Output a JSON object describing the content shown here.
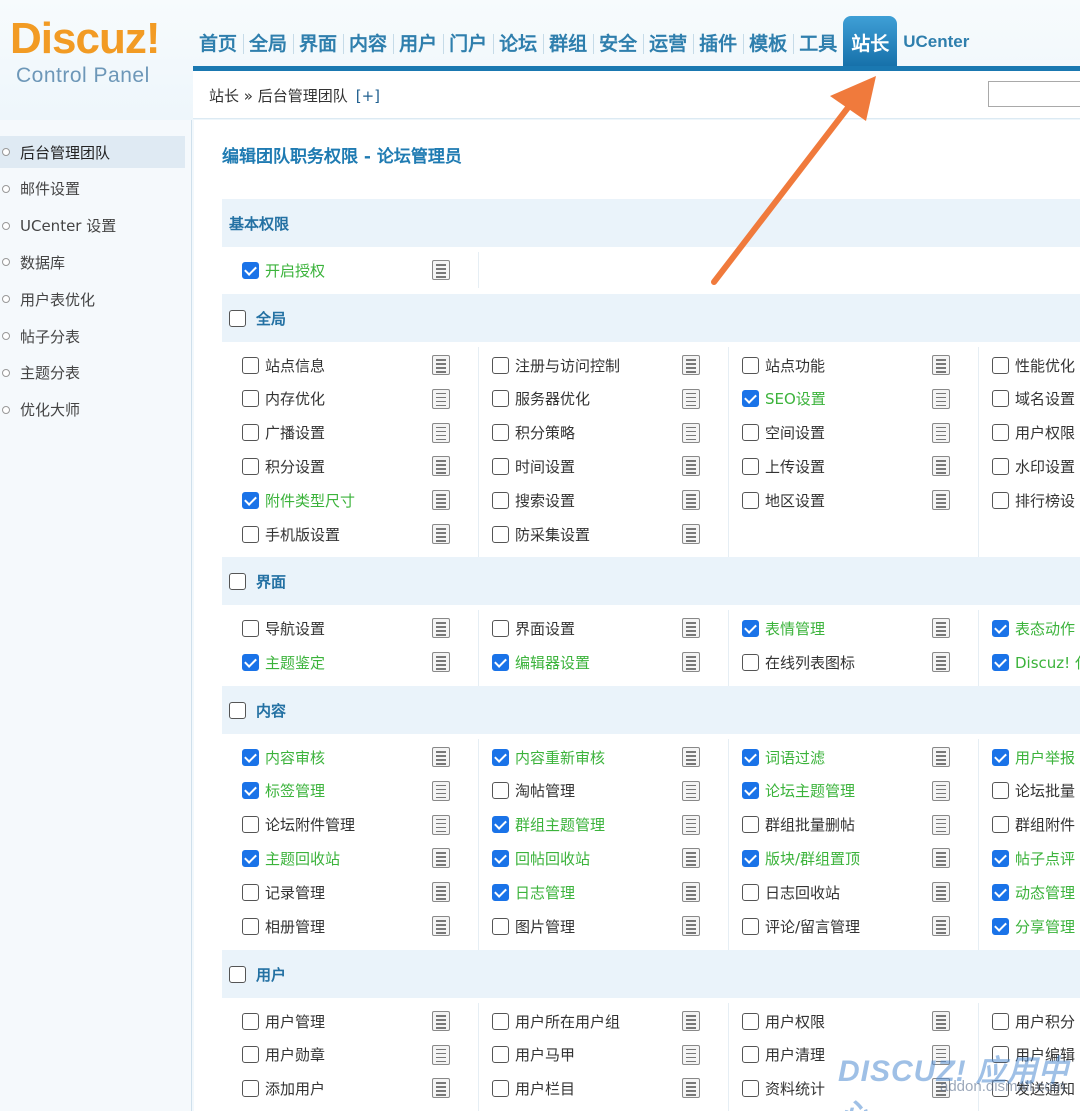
{
  "logo": {
    "main": "Discuz!",
    "sub": "Control Panel"
  },
  "topnav": {
    "items": [
      "首页",
      "全局",
      "界面",
      "内容",
      "用户",
      "门户",
      "论坛",
      "群组",
      "安全",
      "运营",
      "插件",
      "模板",
      "工具",
      "站长",
      "UCenter"
    ],
    "active": "站长"
  },
  "breadcrumb": {
    "text": "站长 » 后台管理团队",
    "plus": "[+]"
  },
  "sidebar": {
    "items": [
      "后台管理团队",
      "邮件设置",
      "UCenter 设置",
      "数据库",
      "用户表优化",
      "帖子分表",
      "主题分表",
      "优化大师"
    ],
    "active": "后台管理团队"
  },
  "page_title": "编辑团队职务权限 - 论坛管理员",
  "sections": {
    "basic": {
      "title": "基本权限",
      "items": [
        {
          "label": "开启授权",
          "checked": true
        }
      ]
    },
    "global": {
      "title": "全局",
      "checked": false,
      "rows": [
        [
          {
            "label": "站点信息",
            "checked": false
          },
          {
            "label": "注册与访问控制",
            "checked": false
          },
          {
            "label": "站点功能",
            "checked": false
          },
          {
            "label": "性能优化",
            "checked": false
          }
        ],
        [
          {
            "label": "内存优化",
            "checked": false
          },
          {
            "label": "服务器优化",
            "checked": false
          },
          {
            "label": "SEO设置",
            "checked": true
          },
          {
            "label": "域名设置",
            "checked": false
          }
        ],
        [
          {
            "label": "广播设置",
            "checked": false
          },
          {
            "label": "积分策略",
            "checked": false
          },
          {
            "label": "空间设置",
            "checked": false
          },
          {
            "label": "用户权限",
            "checked": false
          }
        ],
        [
          {
            "label": "积分设置",
            "checked": false
          },
          {
            "label": "时间设置",
            "checked": false
          },
          {
            "label": "上传设置",
            "checked": false
          },
          {
            "label": "水印设置",
            "checked": false
          }
        ],
        [
          {
            "label": "附件类型尺寸",
            "checked": true
          },
          {
            "label": "搜索设置",
            "checked": false
          },
          {
            "label": "地区设置",
            "checked": false
          },
          {
            "label": "排行榜设",
            "checked": false
          }
        ],
        [
          {
            "label": "手机版设置",
            "checked": false
          },
          {
            "label": "防采集设置",
            "checked": false
          }
        ]
      ]
    },
    "ui": {
      "title": "界面",
      "checked": false,
      "rows": [
        [
          {
            "label": "导航设置",
            "checked": false
          },
          {
            "label": "界面设置",
            "checked": false
          },
          {
            "label": "表情管理",
            "checked": true
          },
          {
            "label": "表态动作",
            "checked": true
          }
        ],
        [
          {
            "label": "主题鉴定",
            "checked": true
          },
          {
            "label": "编辑器设置",
            "checked": true
          },
          {
            "label": "在线列表图标",
            "checked": false
          },
          {
            "label": "Discuz! 代",
            "checked": true
          }
        ]
      ]
    },
    "content": {
      "title": "内容",
      "checked": false,
      "rows": [
        [
          {
            "label": "内容审核",
            "checked": true
          },
          {
            "label": "内容重新审核",
            "checked": true
          },
          {
            "label": "词语过滤",
            "checked": true
          },
          {
            "label": "用户举报",
            "checked": true
          }
        ],
        [
          {
            "label": "标签管理",
            "checked": true
          },
          {
            "label": "淘帖管理",
            "checked": false
          },
          {
            "label": "论坛主题管理",
            "checked": true
          },
          {
            "label": "论坛批量",
            "checked": false
          }
        ],
        [
          {
            "label": "论坛附件管理",
            "checked": false
          },
          {
            "label": "群组主题管理",
            "checked": true
          },
          {
            "label": "群组批量删帖",
            "checked": false
          },
          {
            "label": "群组附件",
            "checked": false
          }
        ],
        [
          {
            "label": "主题回收站",
            "checked": true
          },
          {
            "label": "回帖回收站",
            "checked": true
          },
          {
            "label": "版块/群组置顶",
            "checked": true
          },
          {
            "label": "帖子点评",
            "checked": true
          }
        ],
        [
          {
            "label": "记录管理",
            "checked": false
          },
          {
            "label": "日志管理",
            "checked": true
          },
          {
            "label": "日志回收站",
            "checked": false
          },
          {
            "label": "动态管理",
            "checked": true
          }
        ],
        [
          {
            "label": "相册管理",
            "checked": false
          },
          {
            "label": "图片管理",
            "checked": false
          },
          {
            "label": "评论/留言管理",
            "checked": false
          },
          {
            "label": "分享管理",
            "checked": true
          }
        ]
      ]
    },
    "user": {
      "title": "用户",
      "checked": false,
      "rows": [
        [
          {
            "label": "用户管理",
            "checked": false
          },
          {
            "label": "用户所在用户组",
            "checked": false
          },
          {
            "label": "用户权限",
            "checked": false
          },
          {
            "label": "用户积分",
            "checked": false
          }
        ],
        [
          {
            "label": "用户勋章",
            "checked": false
          },
          {
            "label": "用户马甲",
            "checked": false
          },
          {
            "label": "用户清理",
            "checked": false
          },
          {
            "label": "用户编辑",
            "checked": false
          }
        ],
        [
          {
            "label": "添加用户",
            "checked": false
          },
          {
            "label": "用户栏目",
            "checked": false
          },
          {
            "label": "资料统计",
            "checked": false
          },
          {
            "label": "发送通知",
            "checked": false
          }
        ]
      ]
    }
  },
  "watermark": {
    "main": "DISCUZ! 应用中心",
    "sub": "addon.dismall.com"
  },
  "colors": {
    "accent": "#1f7bb2",
    "checked_label": "#3bb33b",
    "arrow": "#f07a3c",
    "logo": "#f29b24"
  }
}
